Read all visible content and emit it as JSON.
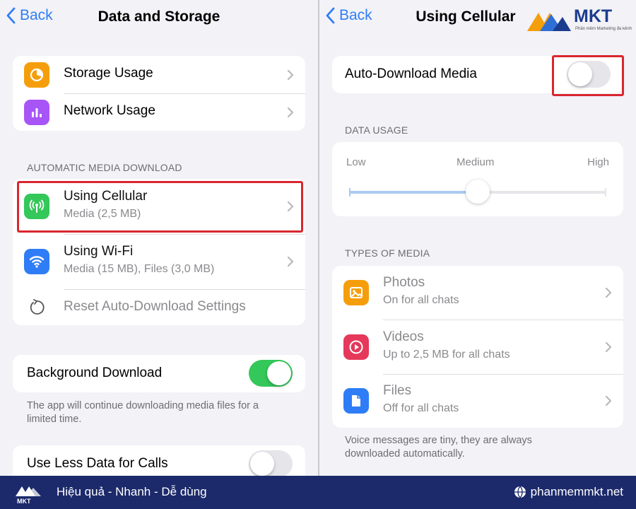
{
  "left": {
    "back_label": "Back",
    "title": "Data and Storage",
    "usage_items": [
      {
        "label": "Storage Usage",
        "icon": "pie-chart-icon",
        "color": "#f59e0b"
      },
      {
        "label": "Network Usage",
        "icon": "bar-chart-icon",
        "color": "#a855f7"
      }
    ],
    "auto_download_header": "AUTOMATIC MEDIA DOWNLOAD",
    "auto_download_items": [
      {
        "label": "Using Cellular",
        "sub": "Media (2,5 MB)",
        "icon": "antenna-icon",
        "color": "#34c759"
      },
      {
        "label": "Using Wi-Fi",
        "sub": "Media (15 MB), Files (3,0 MB)",
        "icon": "wifi-icon",
        "color": "#2f7df6"
      }
    ],
    "reset_label": "Reset Auto-Download Settings",
    "background_download": {
      "label": "Background Download",
      "on": true
    },
    "background_note": "The app will continue downloading media files for a limited time.",
    "less_data_calls": {
      "label": "Use Less Data for Calls",
      "on": false
    }
  },
  "right": {
    "back_label": "Back",
    "title": "Using Cellular",
    "auto_download_media": {
      "label": "Auto-Download Media",
      "on": false
    },
    "data_usage_header": "DATA USAGE",
    "slider": {
      "low": "Low",
      "medium": "Medium",
      "high": "High",
      "value": "Medium"
    },
    "types_header": "TYPES OF MEDIA",
    "media_types": [
      {
        "label": "Photos",
        "sub": "On for all chats",
        "icon": "photo-icon",
        "color": "#f59e0b"
      },
      {
        "label": "Videos",
        "sub": "Up to 2,5 MB for all chats",
        "icon": "video-play-icon",
        "color": "#e5385b"
      },
      {
        "label": "Files",
        "sub": "Off for all chats",
        "icon": "file-icon",
        "color": "#2f7df6"
      }
    ],
    "voice_note": "Voice messages are tiny, they are always downloaded automatically."
  },
  "branding": {
    "logo_text": "MKT",
    "logo_subtext": "Phần mềm Marketing đa kênh",
    "slogan": "Hiệu quả - Nhanh  - Dễ dùng",
    "website": "phanmemmkt.net",
    "bar_color": "#1c2a6b"
  },
  "colors": {
    "accent_blue": "#2f7df6",
    "highlight_red": "#d9262e",
    "toggle_green": "#34c759"
  }
}
